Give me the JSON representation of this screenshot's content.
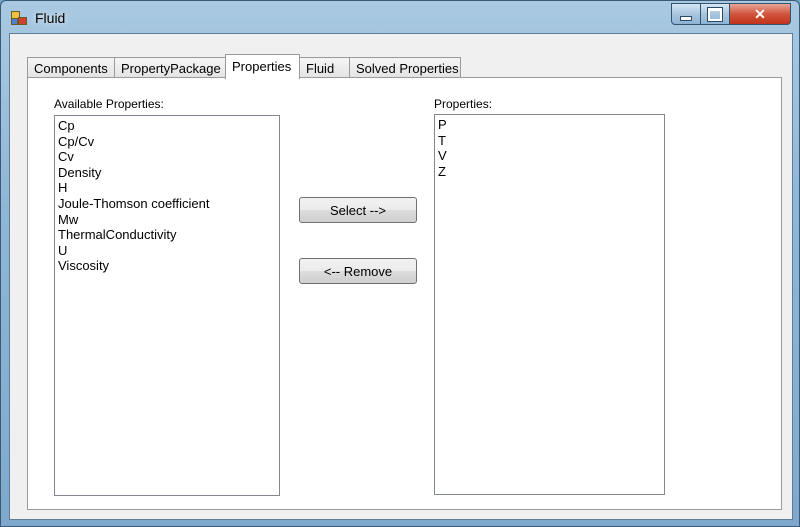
{
  "window": {
    "title": "Fluid"
  },
  "tabs": [
    {
      "label": "Components"
    },
    {
      "label": "PropertyPackage"
    },
    {
      "label": "Properties"
    },
    {
      "label": "Fluid"
    },
    {
      "label": "Solved Properties"
    }
  ],
  "available": {
    "label": "Available Properties:",
    "items": [
      "Cp",
      "Cp/Cv",
      "Cv",
      "Density",
      "H",
      "Joule-Thomson coefficient",
      "Mw",
      "ThermalConductivity",
      "U",
      "Viscosity"
    ]
  },
  "selected": {
    "label": "Properties:",
    "items": [
      "P",
      "T",
      "V",
      "Z"
    ]
  },
  "buttons": {
    "select": "Select -->",
    "remove": "<-- Remove"
  }
}
